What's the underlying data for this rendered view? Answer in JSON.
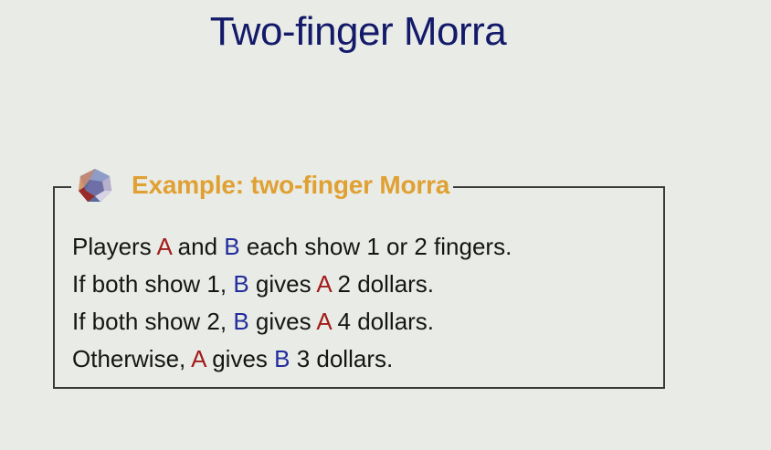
{
  "slide": {
    "title": "Two-finger Morra",
    "box_title": "Example: two-finger Morra",
    "icon": "dodecahedron-icon",
    "colors": {
      "title": "#141a6a",
      "box_title": "#e0a033",
      "player_a": "#a21c1c",
      "player_b": "#232c9c",
      "background": "#e9ece6"
    },
    "lines": [
      {
        "t0": "Players ",
        "a": "A",
        "t1": " and ",
        "b": "B",
        "t2": " each show 1 or 2 fingers."
      },
      {
        "t0": "If both show 1, ",
        "b": "B",
        "t1": " gives ",
        "a": "A",
        "t2": " 2 dollars."
      },
      {
        "t0": "If both show 2, ",
        "b": "B",
        "t1": " gives ",
        "a": "A",
        "t2": " 4 dollars."
      },
      {
        "t0": "Otherwise, ",
        "a": "A",
        "t1": " gives ",
        "b": "B",
        "t2": " 3 dollars."
      }
    ]
  }
}
